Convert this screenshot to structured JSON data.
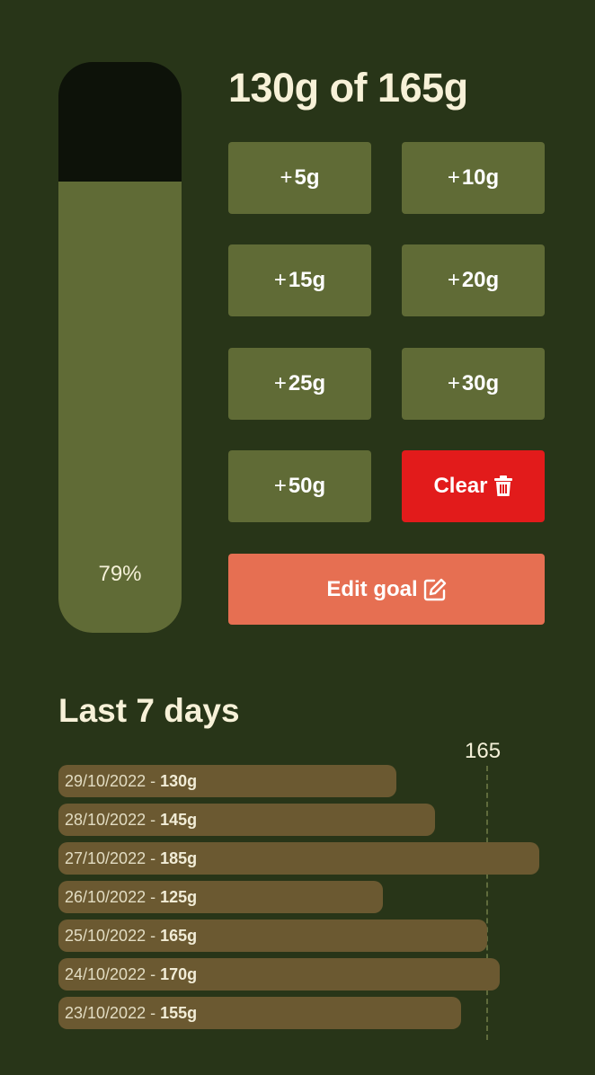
{
  "summary": {
    "consumed": 130,
    "goal": 165,
    "headline": "130g of 165g",
    "percent_label": "79%",
    "fill_fraction": 0.79
  },
  "quick_add": [
    {
      "sign": "+",
      "label": "5g"
    },
    {
      "sign": "+",
      "label": "10g"
    },
    {
      "sign": "+",
      "label": "15g"
    },
    {
      "sign": "+",
      "label": "20g"
    },
    {
      "sign": "+",
      "label": "25g"
    },
    {
      "sign": "+",
      "label": "30g"
    },
    {
      "sign": "+",
      "label": "50g"
    }
  ],
  "clear_button": {
    "label": "Clear",
    "icon": "trash-icon"
  },
  "edit_goal_button": {
    "label": "Edit goal",
    "icon": "edit-icon"
  },
  "history": {
    "title": "Last 7 days",
    "goal_label": "165",
    "goal_value": 165,
    "separator": " - ",
    "entries": [
      {
        "date": "29/10/2022",
        "amount": "130g",
        "value": 130
      },
      {
        "date": "28/10/2022",
        "amount": "145g",
        "value": 145
      },
      {
        "date": "27/10/2022",
        "amount": "185g",
        "value": 185
      },
      {
        "date": "26/10/2022",
        "amount": "125g",
        "value": 125
      },
      {
        "date": "25/10/2022",
        "amount": "165g",
        "value": 165
      },
      {
        "date": "24/10/2022",
        "amount": "170g",
        "value": 170
      },
      {
        "date": "23/10/2022",
        "amount": "155g",
        "value": 155
      }
    ]
  },
  "colors": {
    "background": "#283518",
    "tube_empty": "#0d1209",
    "tube_fill": "#606b36",
    "button": "#606b36",
    "clear": "#e21b1b",
    "edit": "#e66f52",
    "history_bar": "#6b5931",
    "text": "#f7f1d8"
  }
}
